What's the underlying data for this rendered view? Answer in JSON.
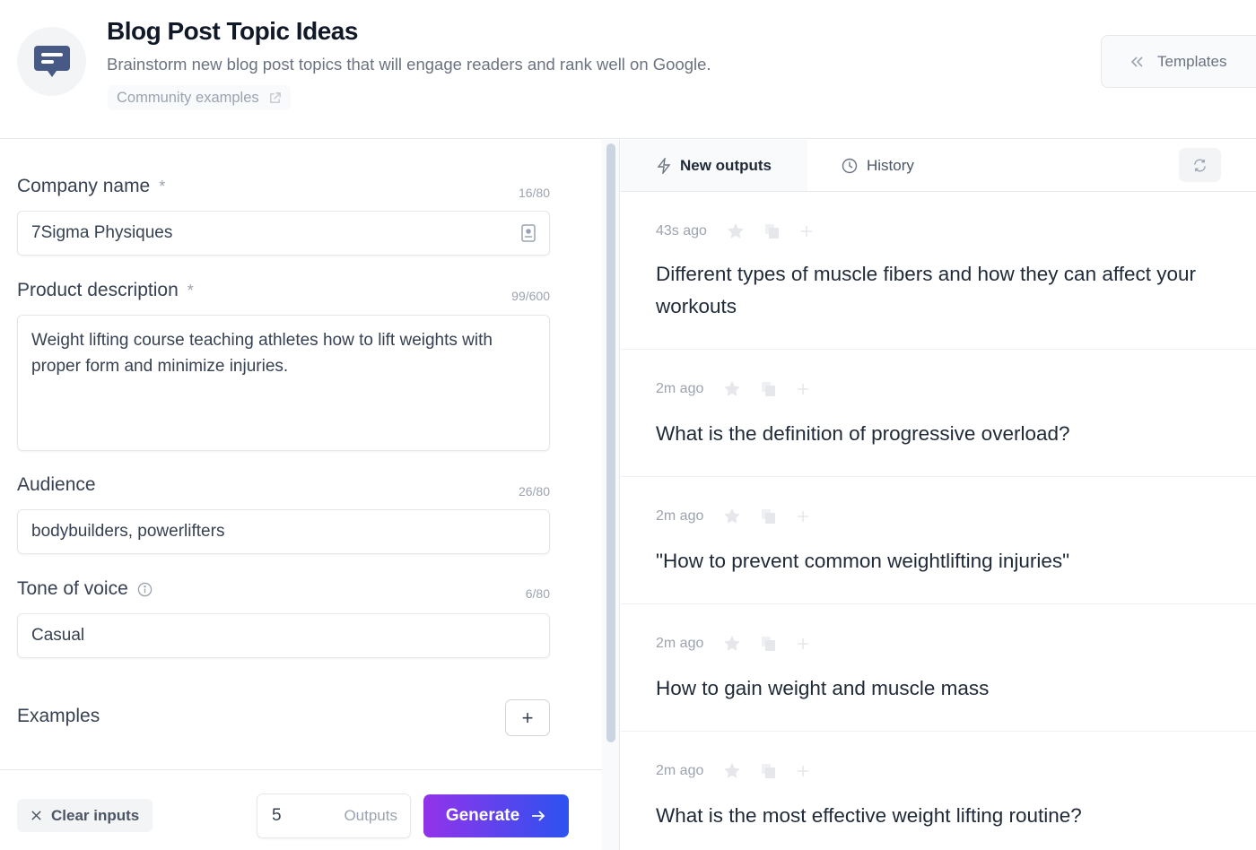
{
  "header": {
    "title": "Blog Post Topic Ideas",
    "subtitle": "Brainstorm new blog post topics that will engage readers and rank well on Google.",
    "community_link": "Community examples",
    "templates_button": "Templates"
  },
  "form": {
    "fields": [
      {
        "label": "Company name",
        "required": "*",
        "counter": "16/80",
        "value": "7Sigma Physiques"
      },
      {
        "label": "Product description",
        "required": "*",
        "counter": "99/600",
        "value": "Weight lifting course teaching athletes how to lift weights with proper form and minimize injuries."
      },
      {
        "label": "Audience",
        "counter": "26/80",
        "value": "bodybuilders, powerlifters"
      },
      {
        "label": "Tone of voice",
        "counter": "6/80",
        "value": "Casual"
      }
    ],
    "examples_label": "Examples",
    "add_example": "+"
  },
  "footer": {
    "clear_label": "Clear inputs",
    "outputs_count": "5",
    "outputs_label": "Outputs",
    "generate_label": "Generate"
  },
  "outputs_panel": {
    "tabs": [
      {
        "label": "New outputs",
        "active": true
      },
      {
        "label": "History",
        "active": false
      }
    ],
    "items": [
      {
        "time": "43s ago",
        "text": "Different types of muscle fibers and how they can affect your workouts"
      },
      {
        "time": "2m ago",
        "text": "What is the definition of progressive overload?"
      },
      {
        "time": "2m ago",
        "text": "\"How to prevent common weightlifting injuries\""
      },
      {
        "time": "2m ago",
        "text": "How to gain weight and muscle mass"
      },
      {
        "time": "2m ago",
        "text": "What is the most effective weight lifting routine?"
      }
    ]
  },
  "colors": {
    "brand_icon": "#475a86",
    "generate_gradient_start": "#9333ea",
    "generate_gradient_end": "#2c52f0"
  }
}
